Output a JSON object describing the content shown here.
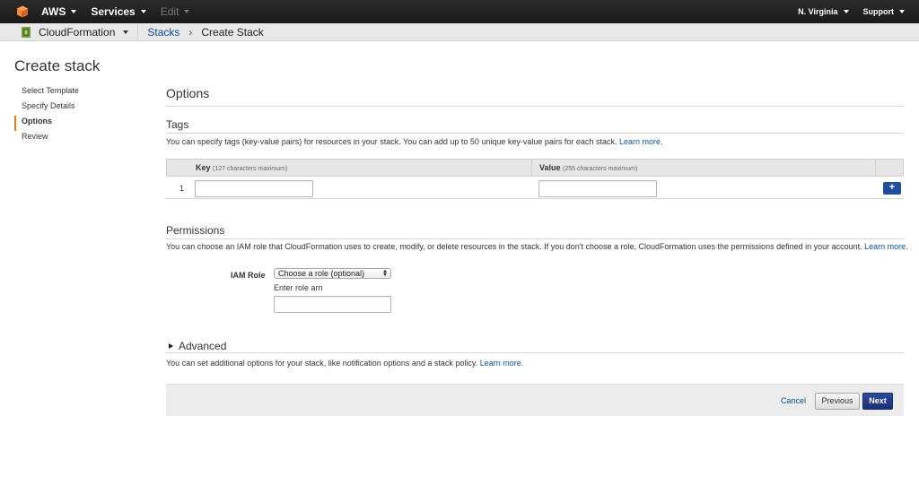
{
  "topnav": {
    "brand": "AWS",
    "services": "Services",
    "edit": "Edit",
    "region": "N. Virginia",
    "support": "Support"
  },
  "subnav": {
    "service": "CloudFormation",
    "breadcrumb_link": "Stacks",
    "breadcrumb_sep": "›",
    "breadcrumb_current": "Create Stack"
  },
  "page": {
    "title": "Create stack"
  },
  "steps": [
    "Select Template",
    "Specify Details",
    "Options",
    "Review"
  ],
  "options": {
    "heading": "Options"
  },
  "tags": {
    "heading": "Tags",
    "description": "You can specify tags (key-value pairs) for resources in your stack. You can add up to 50 unique key-value pairs for each stack.",
    "learn_more": "Learn more.",
    "key_header": "Key",
    "key_hint": "(127 characters maximum)",
    "value_header": "Value",
    "value_hint": "(255 characters maximum)",
    "row_number": "1",
    "key_value": "",
    "value_value": "",
    "add_label": "+"
  },
  "permissions": {
    "heading": "Permissions",
    "description": "You can choose an IAM role that CloudFormation uses to create, modify, or delete resources in the stack. If you don't choose a role, CloudFormation uses the permissions defined in your account.",
    "learn_more": "Learn more.",
    "iam_label": "IAM Role",
    "select_value": "Choose a role (optional)",
    "arn_label": "Enter role arn",
    "arn_value": ""
  },
  "advanced": {
    "heading": "Advanced",
    "description": "You can set additional options for your stack, like notification options and a stack policy.",
    "learn_more": "Learn more."
  },
  "footer": {
    "cancel": "Cancel",
    "previous": "Previous",
    "next": "Next"
  },
  "colors": {
    "active_step_marker": "#e47911",
    "link": "#0b4f97",
    "primary_button": "#1f3c8a"
  }
}
